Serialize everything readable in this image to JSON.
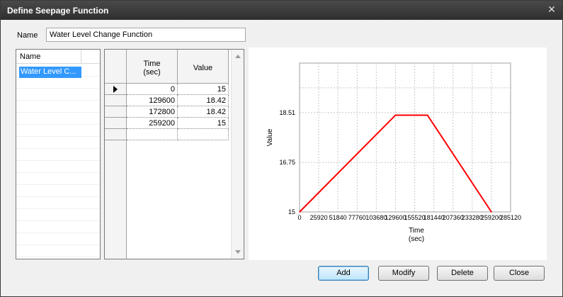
{
  "window": {
    "title": "Define Seepage Function",
    "close_glyph": "✕"
  },
  "name_field": {
    "label": "Name",
    "value": "Water Level Change Function"
  },
  "function_list": {
    "header": "Name",
    "items": [
      "Water Level C..."
    ]
  },
  "data_grid": {
    "columns": [
      {
        "line1": "Time",
        "line2": "(sec)"
      },
      {
        "line1": "Value",
        "line2": ""
      }
    ],
    "rows": [
      {
        "time": "0",
        "value": "15",
        "current": true
      },
      {
        "time": "129600",
        "value": "18.42",
        "current": false
      },
      {
        "time": "172800",
        "value": "18.42",
        "current": false
      },
      {
        "time": "259200",
        "value": "15",
        "current": false
      },
      {
        "time": "",
        "value": "",
        "current": false
      }
    ]
  },
  "chart_data": {
    "type": "line",
    "title": "",
    "xlabel": "Time\n(sec)",
    "ylabel": "Value",
    "xlim": [
      0,
      285120
    ],
    "ylim": [
      15,
      20.26
    ],
    "x_ticks": [
      0,
      25920,
      51840,
      77760,
      103680,
      129600,
      155520,
      181440,
      207360,
      233280,
      259200,
      285120
    ],
    "y_ticks": [
      15,
      16.75,
      18.51
    ],
    "grid": true,
    "series": [
      {
        "x": [
          0,
          129600,
          172800,
          259200
        ],
        "y": [
          15,
          18.42,
          18.42,
          15
        ],
        "color": "#ff0000"
      }
    ]
  },
  "buttons": {
    "add": "Add",
    "modify": "Modify",
    "delete": "Delete",
    "close": "Close"
  }
}
